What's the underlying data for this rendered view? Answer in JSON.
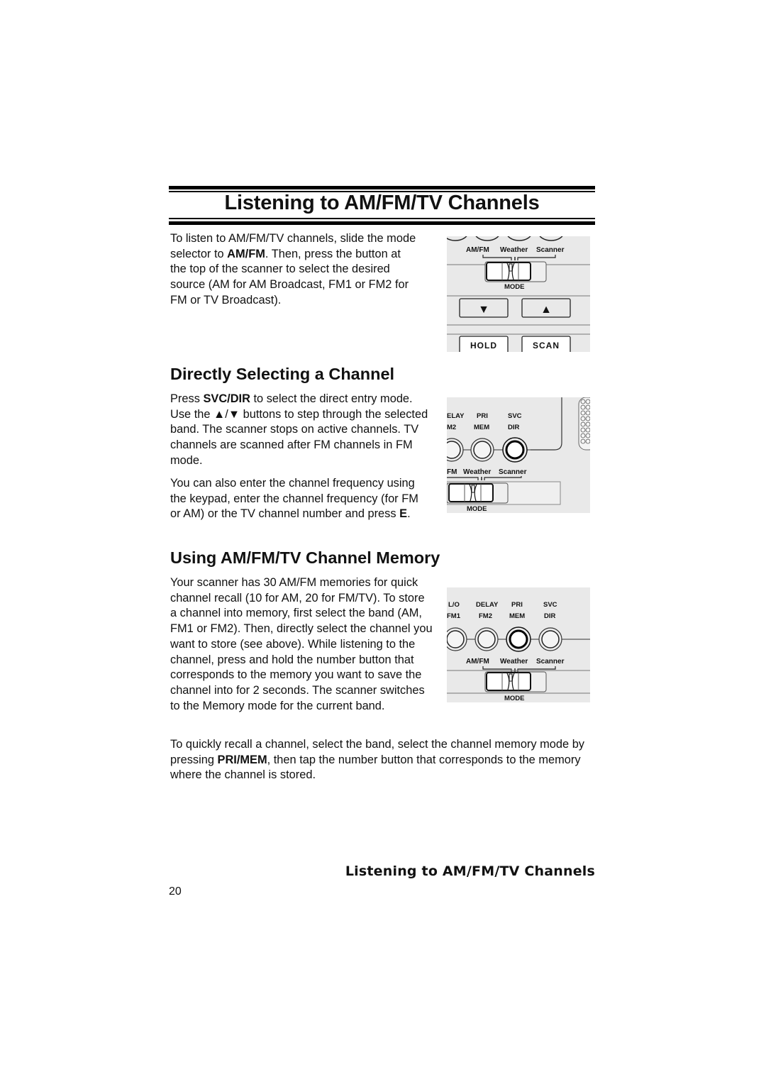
{
  "page": {
    "title": "Listening to AM/FM/TV Channels",
    "footer_title": "Listening to AM/FM/TV Channels",
    "page_number": "20"
  },
  "intro": {
    "text_1": "To listen to AM/FM/TV channels, slide the mode selector to ",
    "bold_1": "AM/FM",
    "text_2": ". Then, press the button at the top of the scanner to select the desired source (AM for AM Broadcast, FM1 or FM2 for FM or TV Broadcast)."
  },
  "section_direct": {
    "heading": "Directly Selecting a Channel",
    "p1_text_1": "Press ",
    "p1_bold_1": "SVC/DIR",
    "p1_text_2": " to select the direct entry mode. Use the ▲/▼ buttons to step through the selected band. The scanner stops on active channels. TV channels are scanned after FM channels in FM mode.",
    "p2_text_1": "You can also enter the channel frequency using the keypad, enter the channel frequency (for FM or AM) or the TV channel number and press ",
    "p2_bold_1": "E",
    "p2_text_2": "."
  },
  "section_memory": {
    "heading": "Using AM/FM/TV Channel Memory",
    "p1": "Your scanner has 30 AM/FM memories for quick channel recall (10 for AM, 20 for FM/TV). To store a channel into memory, first select the band (AM, FM1 or FM2). Then, directly select the channel you want to store (see above). While listening to the channel, press and hold the number button that corresponds to the memory you want to save the channel into for 2 seconds. The scanner switches to the Memory mode for the current band.",
    "p2_text_1": "To quickly recall a channel, select the band, select the channel memory mode by pressing ",
    "p2_bold_1": "PRI/MEM",
    "p2_text_2": ", then tap the number button that corresponds to the memory where the channel is stored."
  },
  "figure_1": {
    "mode_labels": [
      "AM/FM",
      "Weather",
      "Scanner"
    ],
    "mode_caption": "MODE",
    "down_button": "▼",
    "up_button": "▲",
    "hold_button": "HOLD",
    "scan_button": "SCAN"
  },
  "figure_2": {
    "button_labels_top": [
      "ELAY",
      "PRI",
      "SVC"
    ],
    "button_labels_bottom": [
      "M2",
      "MEM",
      "DIR"
    ],
    "mode_labels": [
      "FM",
      "Weather",
      "Scanner"
    ],
    "mode_caption": "MODE"
  },
  "figure_3": {
    "button_labels_top": [
      "L/O",
      "DELAY",
      "PRI",
      "SVC"
    ],
    "button_labels_bottom": [
      "FM1",
      "FM2",
      "MEM",
      "DIR"
    ],
    "mode_labels": [
      "AM/FM",
      "Weather",
      "Scanner"
    ],
    "mode_caption": "MODE"
  },
  "colors": {
    "illustration_bg": "#e9e9e9",
    "ink": "#111111"
  }
}
